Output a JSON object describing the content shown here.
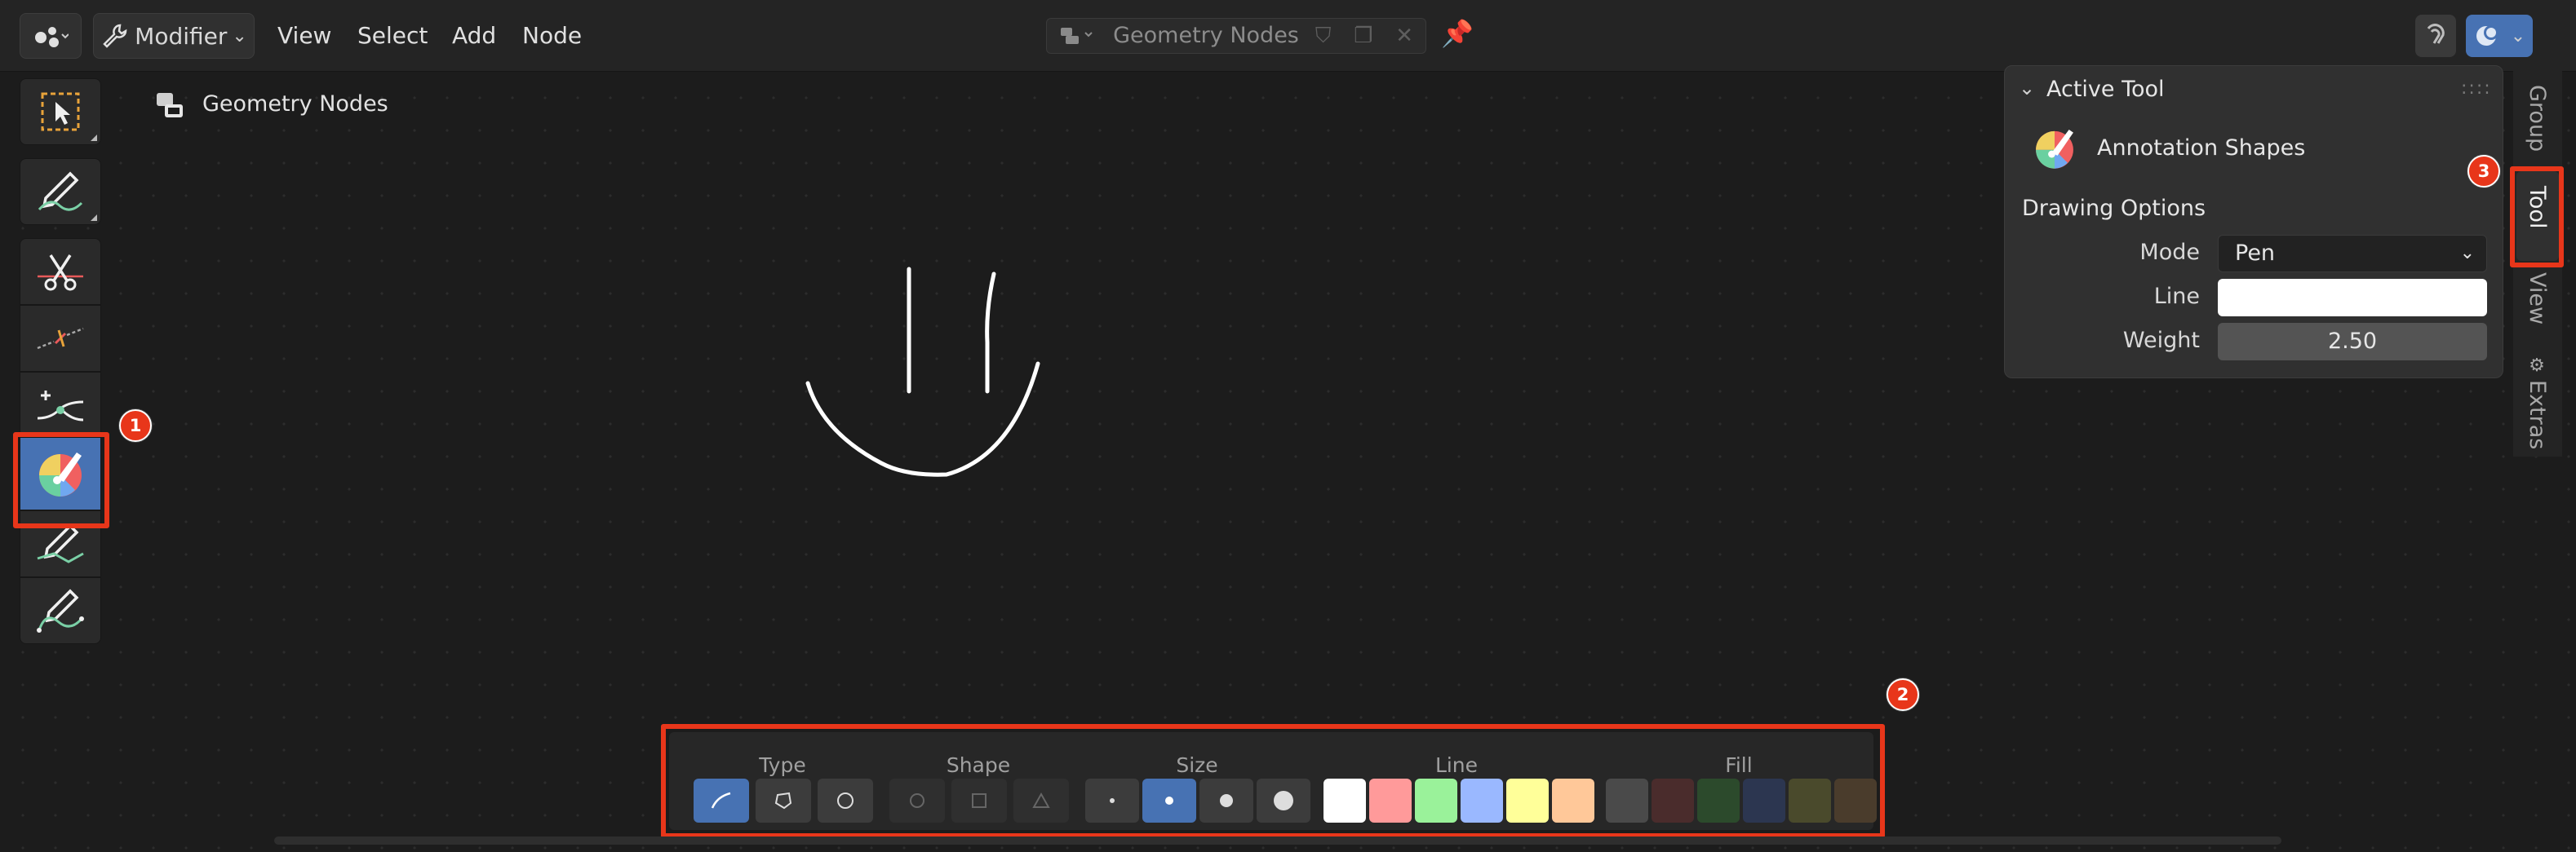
{
  "header": {
    "mode_label": "Modifier",
    "menu": [
      "View",
      "Select",
      "Add",
      "Node"
    ],
    "node_tree_name": "Geometry Nodes"
  },
  "breadcrumb": {
    "label": "Geometry Nodes"
  },
  "n_panel": {
    "section_title": "Active Tool",
    "tool_name": "Annotation Shapes",
    "subsection": "Drawing Options",
    "mode_label": "Mode",
    "mode_value": "Pen",
    "line_label": "Line",
    "line_color": "#ffffff",
    "weight_label": "Weight",
    "weight_value": "2.50"
  },
  "side_tabs": [
    "Group",
    "Tool",
    "View",
    "Extras"
  ],
  "bottom_bar": {
    "groups": [
      "Type",
      "Shape",
      "Size",
      "Line",
      "Fill"
    ],
    "line_colors": [
      "#ffffff",
      "#ff9a9a",
      "#9af29a",
      "#9ab8ff",
      "#ffff99",
      "#ffc899"
    ],
    "fill_colors": [
      "#4a4a4a",
      "#4a2c2c",
      "#2c4a2c",
      "#2c3650",
      "#4a4a2c",
      "#4a3c2c"
    ]
  },
  "markers": [
    "1",
    "2",
    "3"
  ],
  "colors": {
    "accent": "#4772b3",
    "highlight": "#e8361a"
  }
}
